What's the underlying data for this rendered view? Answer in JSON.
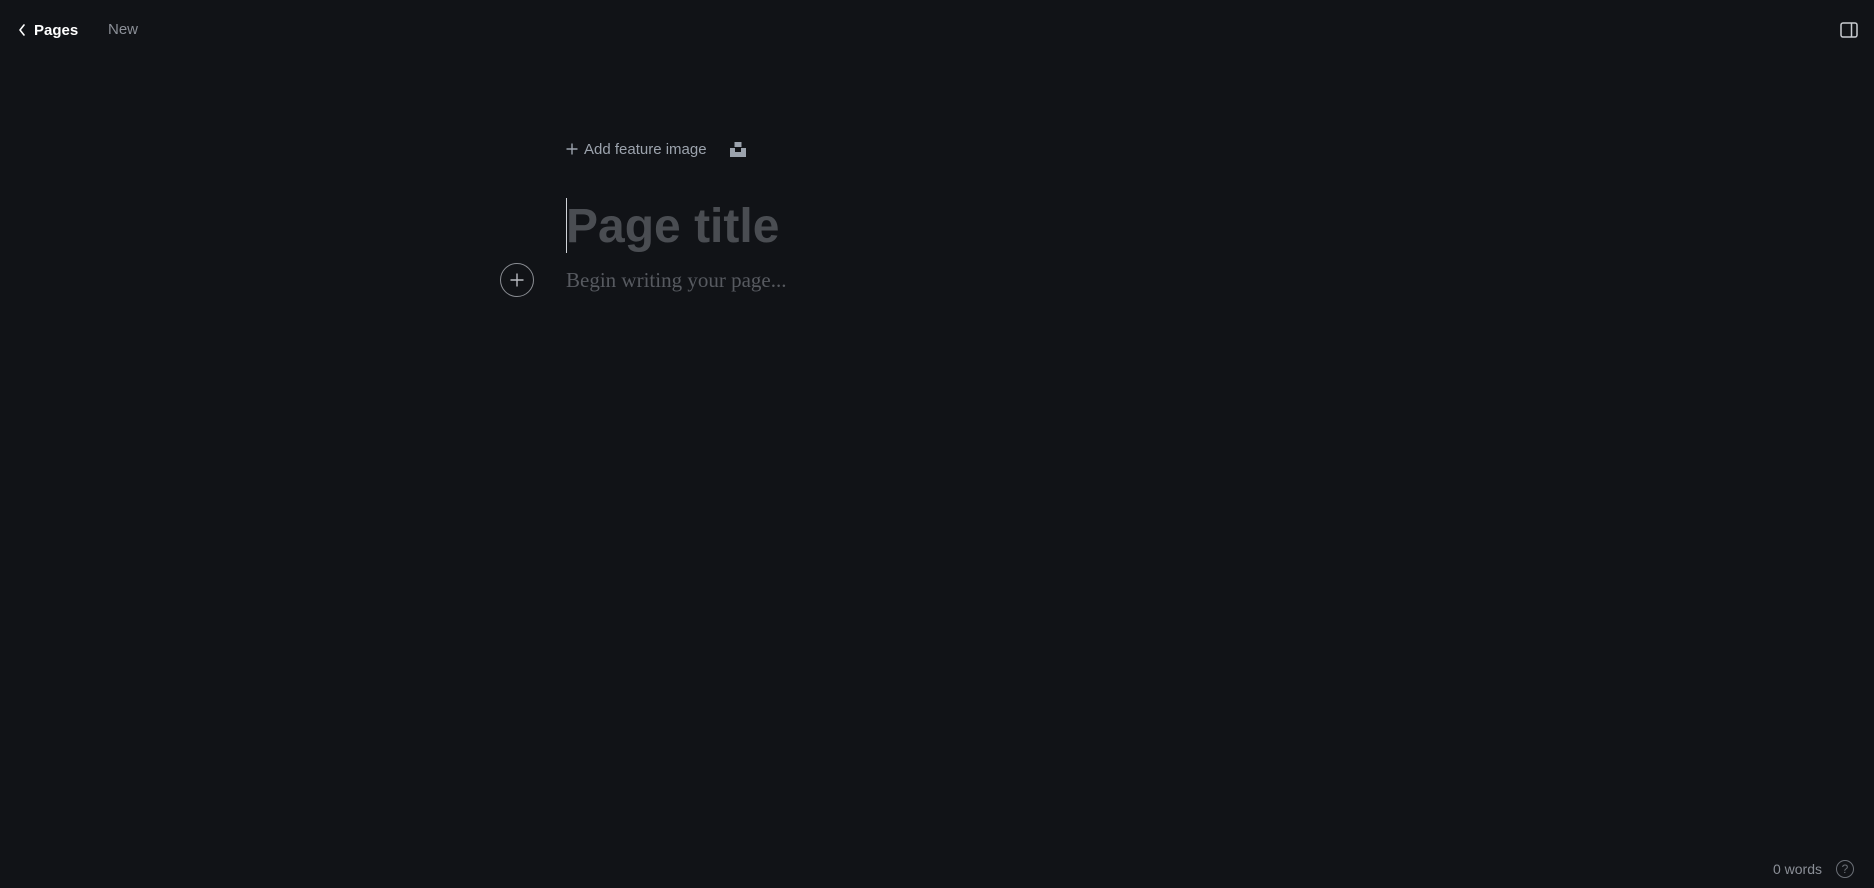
{
  "header": {
    "back_label": "Pages",
    "status": "New"
  },
  "editor": {
    "feature_image_label": "Add feature image",
    "title_placeholder": "Page title",
    "body_placeholder": "Begin writing your page..."
  },
  "footer": {
    "word_count": "0 words",
    "help_glyph": "?"
  },
  "icons": {
    "back": "chevron-left-icon",
    "sidebar_toggle": "sidebar-panel-icon",
    "feature_add": "plus-icon",
    "unsplash": "unsplash-icon",
    "card_add": "plus-circle-icon",
    "help": "question-circle-icon"
  },
  "colors": {
    "background": "#111317",
    "primary_text": "#ffffff",
    "muted_text": "#8b8f97",
    "placeholder_text": "#4a4d52"
  }
}
